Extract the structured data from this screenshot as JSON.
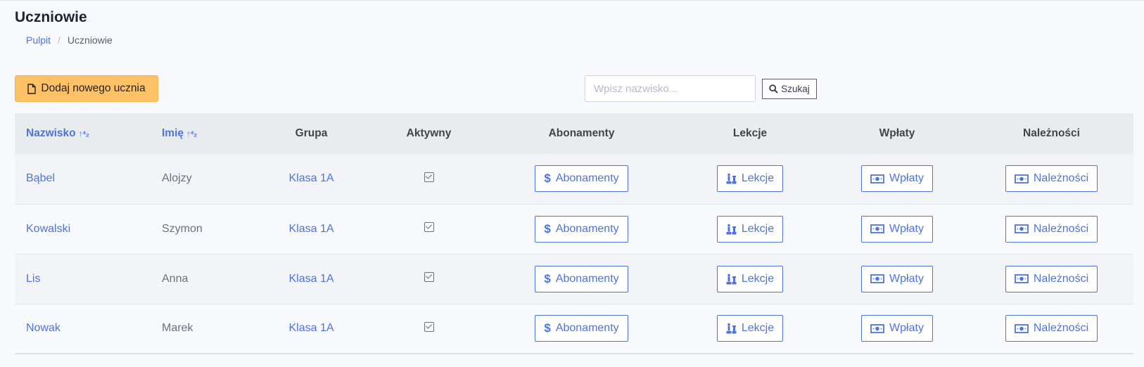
{
  "page": {
    "title": "Uczniowie",
    "breadcrumb": {
      "home": "Pulpit",
      "separator": "/",
      "current": "Uczniowie"
    }
  },
  "toolbar": {
    "add_label": "Dodaj nowego ucznia",
    "add_icon": "file-icon",
    "search_placeholder": "Wpisz nazwisko...",
    "search_value": "",
    "search_label": "Szukaj",
    "search_icon": "search-icon"
  },
  "table": {
    "headers": {
      "surname": "Nazwisko",
      "name": "Imię",
      "group": "Grupa",
      "active": "Aktywny",
      "subscriptions": "Abonamenty",
      "lessons": "Lekcje",
      "payments": "Wpłaty",
      "dues": "Należności"
    },
    "action_labels": {
      "subscriptions": "Abonamenty",
      "lessons": "Lekcje",
      "payments": "Wpłaty",
      "dues": "Należności"
    },
    "rows": [
      {
        "surname": "Bąbel",
        "name": "Alojzy",
        "group": "Klasa 1A",
        "active": true
      },
      {
        "surname": "Kowalski",
        "name": "Szymon",
        "group": "Klasa 1A",
        "active": true
      },
      {
        "surname": "Lis",
        "name": "Anna",
        "group": "Klasa 1A",
        "active": true
      },
      {
        "surname": "Nowak",
        "name": "Marek",
        "group": "Klasa 1A",
        "active": true
      }
    ]
  },
  "colors": {
    "accent": "#4e73df",
    "add_button": "#ffc166",
    "header_bg": "#e9ecef"
  }
}
